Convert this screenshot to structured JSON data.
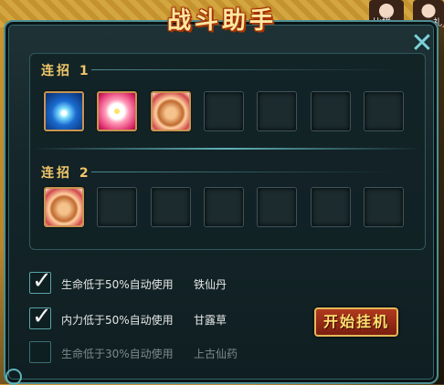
{
  "window": {
    "title": "战斗助手",
    "close_symbol": "✕"
  },
  "top_bar": {
    "avatar_label": "比拼",
    "avatar2_label": "礼"
  },
  "combos": [
    {
      "label": "连招 1",
      "skills": [
        "lightning-skill",
        "flower-skill",
        "fist-skill"
      ],
      "slot_count": 7
    },
    {
      "label": "连招 2",
      "skills": [
        "fist-skill"
      ],
      "slot_count": 7
    }
  ],
  "options": [
    {
      "checked": true,
      "text": "生命低于50%自动使用",
      "item": "铁仙丹",
      "enabled": true
    },
    {
      "checked": true,
      "text": "内力低于50%自动使用",
      "item": "甘露草",
      "enabled": true
    },
    {
      "checked": false,
      "text": "生命低于30%自动使用",
      "item": "上古仙药",
      "enabled": false
    }
  ],
  "start_button": "开始挂机",
  "check_symbol": "✓"
}
